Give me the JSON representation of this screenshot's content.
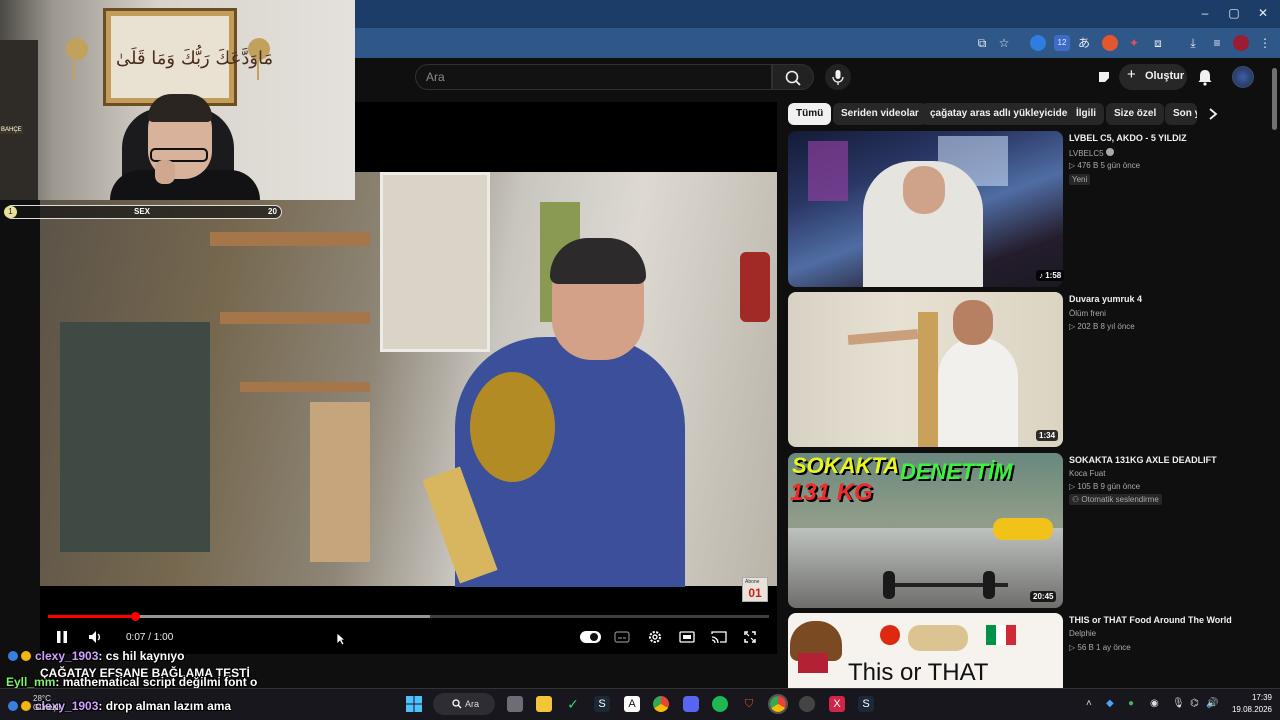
{
  "browser": {
    "window_controls": [
      "–",
      "▢",
      "✕"
    ],
    "ext_badge": "12"
  },
  "header": {
    "search_placeholder": "Ara",
    "create_label": "Oluştur"
  },
  "webcam": {
    "frame_text": "مَاوَدَّعَكَ رَبُّكَ وَمَا قَلَىٰ",
    "overlay_left": "1",
    "overlay_label": "SEX",
    "overlay_right": "20",
    "sign": "BAHÇE"
  },
  "player": {
    "time": "0:07 / 1:00",
    "progress_played": 0.12,
    "progress_buffered": 0.53,
    "abone_top": "Abone",
    "abone_num": "01"
  },
  "chips": [
    {
      "label": "Tümü",
      "active": true
    },
    {
      "label": "Seriden videolar"
    },
    {
      "label": "çağatay aras adlı yükleyiciden"
    },
    {
      "label": "İlgili"
    },
    {
      "label": "Size özel"
    },
    {
      "label": "Son y"
    }
  ],
  "recommendations": [
    {
      "title": "LVBEL C5, AKDO - 5 YILDIZ",
      "channel": "LVBELC5",
      "meta": "▷ 476 B   5 gün önce",
      "badge": "Yeni",
      "duration": "1:58"
    },
    {
      "title": "Duvara yumruk 4",
      "channel": "Ölüm freni",
      "meta": "▷ 202 B   8 yıl önce",
      "duration": "1:34"
    },
    {
      "title": "SOKAKTA 131KG AXLE DEADLIFT",
      "channel": "Koca Fuat",
      "meta": "▷ 105 B   9 gün önce",
      "badge": "Otomatik seslendirme",
      "duration": "20:45",
      "thumb_text_1": "SOKAKTA",
      "thumb_text_2": "131 KG",
      "thumb_text_3": "DENETTİM"
    },
    {
      "title": "THIS or THAT Food Around The World",
      "channel": "Delphie",
      "meta": "▷ 56 B   1 ay önce",
      "thumb_text": "This or THAT"
    }
  ],
  "chat": [
    {
      "user": "clexy_1903",
      "message": ": cs hil kaynıyo"
    },
    {
      "user": "Eyll_mm",
      "message": ": mathematical script değilmi font o"
    },
    {
      "user": "clexy_1903",
      "message": ": drop alman lazım ama"
    }
  ],
  "chat_title": "ÇAĞATAY EFSANE BAĞLAMA TESTİ",
  "taskbar": {
    "weather_temp": "28°C",
    "weather_desc": "Güneşli",
    "search_label": "Ara",
    "time": "17:39",
    "date": "19.08.2026"
  },
  "colors": {
    "youtube_red": "#ff0000",
    "chat_user_purple": "#d1a1ff",
    "chat_user_green": "#7df36e",
    "browser_blue": "#2f5788"
  }
}
